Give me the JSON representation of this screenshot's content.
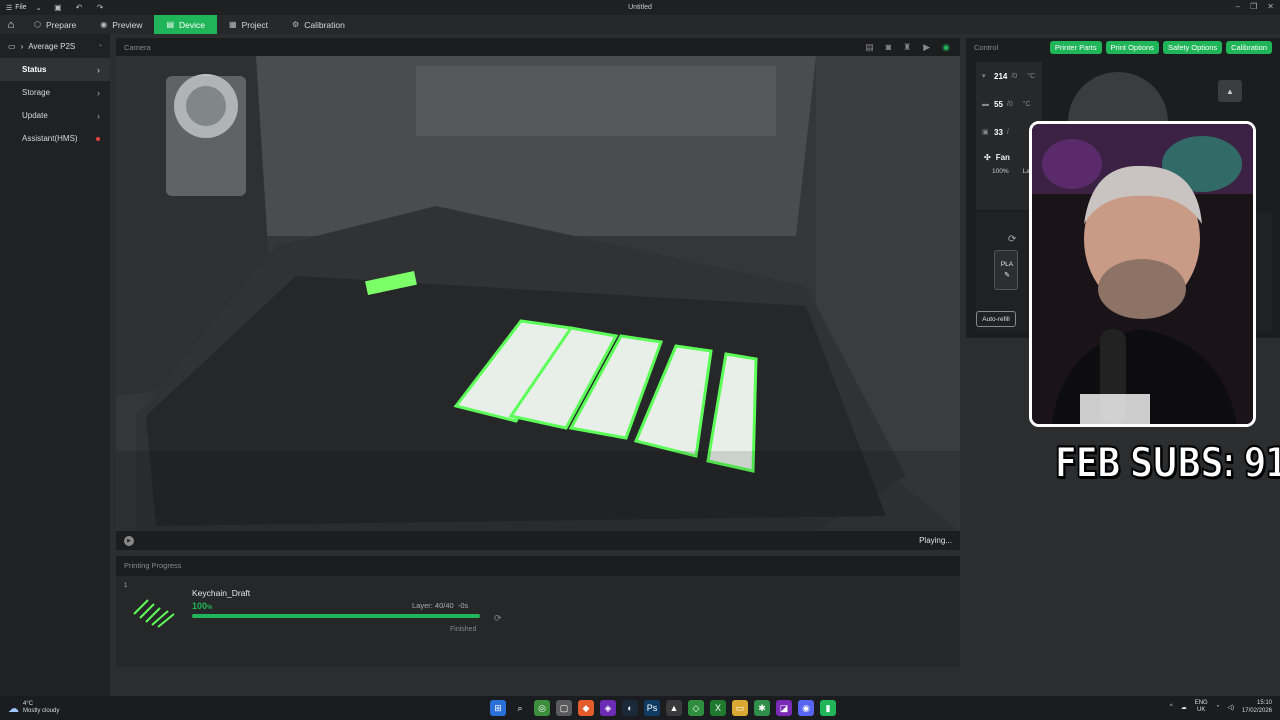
{
  "titlebar": {
    "file_label": "File",
    "title": "Untitled"
  },
  "tabs": [
    {
      "label": "Prepare",
      "icon": "cube-icon"
    },
    {
      "label": "Preview",
      "icon": "eye-icon"
    },
    {
      "label": "Device",
      "icon": "device-icon",
      "active": true
    },
    {
      "label": "Project",
      "icon": "project-icon"
    },
    {
      "label": "Calibration",
      "icon": "gear-icon"
    }
  ],
  "sidebar": {
    "device_name": "Average P2S",
    "items": [
      {
        "label": "Status",
        "active": true
      },
      {
        "label": "Storage"
      },
      {
        "label": "Update"
      },
      {
        "label": "Assistant(HMS)",
        "alert": true
      }
    ]
  },
  "camera": {
    "header": "Camera",
    "status": "Playing..."
  },
  "progress": {
    "header": "Printing Progress",
    "plate": "1",
    "job_name": "Keychain_Draft",
    "percent": "100",
    "percent_unit": "%",
    "percent_value": 1.0,
    "layer": "Layer: 40/40",
    "time_left": "-0s",
    "state": "Finished"
  },
  "control": {
    "header": "Control",
    "buttons": [
      "Printer Parts",
      "Print Options",
      "Safety Options",
      "Calibration"
    ],
    "nozzle": {
      "current": "214",
      "target": "/0",
      "unit": "°C"
    },
    "bed": {
      "current": "55",
      "target": "/0",
      "unit": "°C"
    },
    "chamber": {
      "current": "33",
      "target": "/"
    },
    "fan_label": "Fan",
    "fan_speed": "100%",
    "lamp_label": "La",
    "slot_type": "PLA",
    "auto_refill": "Auto-refill"
  },
  "overlay": {
    "subs_text": "FEB SUBS: 91"
  },
  "taskbar": {
    "temp": "4°C",
    "weather": "Mostly cloudy",
    "lang_top": "ENG",
    "lang_bottom": "UK",
    "time": "15:10",
    "date": "17/02/2026"
  },
  "colors": {
    "accent": "#21b559",
    "alert": "#e0423c"
  }
}
